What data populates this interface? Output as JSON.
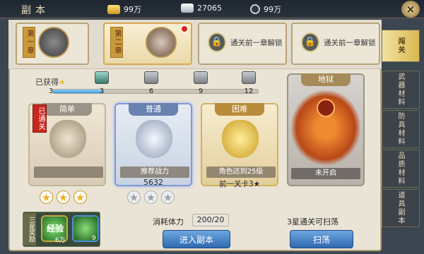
{
  "header": {
    "title": "副本",
    "gold": "99万",
    "silver": "27065",
    "gems": "99万",
    "close": "×"
  },
  "chapters": [
    {
      "tag": "第一章"
    },
    {
      "tag": "第二章"
    },
    {
      "locked_text": "通关前一章解锁"
    },
    {
      "locked_text": "通关前一章解锁"
    }
  ],
  "right_tabs": [
    "闯关",
    "武器材料",
    "防具材料",
    "品质材料",
    "道具副本"
  ],
  "progress": {
    "label": "已获得",
    "current": "3",
    "milestones": [
      "3",
      "6",
      "9",
      "12"
    ],
    "fraction": 0.25
  },
  "cards": [
    {
      "head": "简单",
      "badge": "已通关",
      "stars_on": 3
    },
    {
      "head": "普通",
      "sub": "推荐战力",
      "power": "5632",
      "stars_on": 0
    },
    {
      "head": "困难",
      "sub": "角色达到25级",
      "req": "前一关卡3★"
    },
    {
      "head": "地狱",
      "sub": "未开启"
    }
  ],
  "bottom": {
    "reward_label": "三星奖励",
    "reward1": {
      "name": "经验",
      "count": "6万"
    },
    "reward2": {
      "count": "9"
    },
    "cost_label": "消耗体力",
    "cost_value": "200/20",
    "hint": "3星通关可扫荡",
    "enter": "进入副本",
    "sweep": "扫荡"
  },
  "colors": {
    "accent": "#3f7fc8",
    "gold": "#f0b820",
    "cleared": "#c8261e"
  }
}
